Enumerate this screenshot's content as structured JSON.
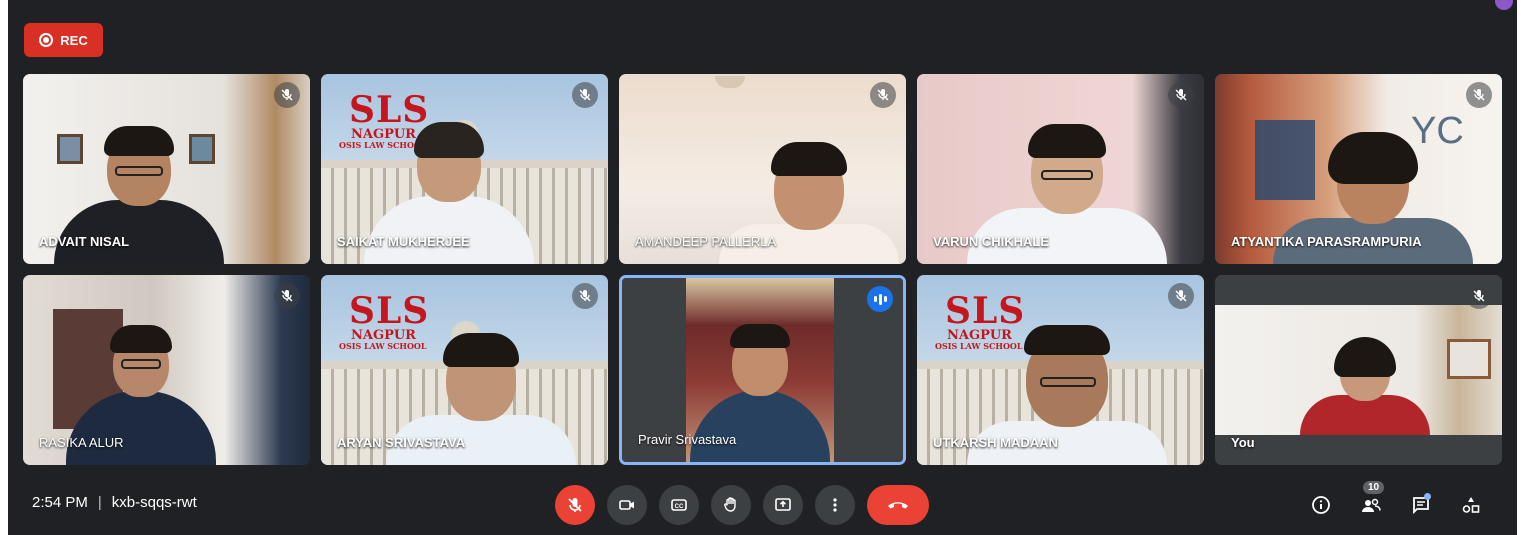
{
  "recording": {
    "label": "REC",
    "color": "#d93025"
  },
  "participants": [
    {
      "name": "ADVAIT NISAL",
      "status": "mic-off-icon"
    },
    {
      "name": "SAIKAT MUKHERJEE",
      "status": "mic-off-icon"
    },
    {
      "name": "AMANDEEP PALLERLA",
      "status": "mic-off-icon"
    },
    {
      "name": "VARUN CHIKHALE",
      "status": "mic-off-icon"
    },
    {
      "name": "ATYANTIKA PARASRAMPURIA",
      "status": "mic-off-icon"
    },
    {
      "name": "RASIKA ALUR",
      "status": "mic-off-icon"
    },
    {
      "name": "ARYAN SRIVASTAVA",
      "status": "mic-off-icon"
    },
    {
      "name": "Pravir Srivastava",
      "status": "speaking-icon"
    },
    {
      "name": "UTKARSH MADAAN",
      "status": "mic-off-icon"
    },
    {
      "name": "You",
      "status": "mic-off-icon"
    }
  ],
  "virtual_background": {
    "title": "SLS",
    "subtitle": "NAGPUR",
    "tagline": "OSIS LAW SCHOOL"
  },
  "meeting": {
    "time": "2:54 PM",
    "separator": "|",
    "code": "kxb-sqqs-rwt"
  },
  "toolbar": {
    "buttons": [
      "mic-off-icon",
      "camera-icon",
      "captions-icon",
      "raise-hand-icon",
      "present-icon",
      "more-options-icon",
      "end-call-icon"
    ]
  },
  "side_tools": {
    "people_count": "10",
    "icons": [
      "info-icon",
      "people-icon",
      "chat-icon",
      "activities-icon"
    ]
  },
  "colors": {
    "background": "#202124",
    "tile": "#3c4043",
    "accent": "#8ab4f8",
    "danger": "#ea4335"
  }
}
